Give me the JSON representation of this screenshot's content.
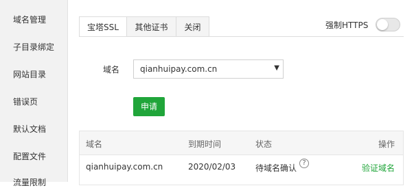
{
  "sidebar": {
    "items": [
      {
        "label": "域名管理"
      },
      {
        "label": "子目录绑定"
      },
      {
        "label": "网站目录"
      },
      {
        "label": "错误页"
      },
      {
        "label": "默认文档"
      },
      {
        "label": "配置文件"
      },
      {
        "label": "流量限制"
      }
    ]
  },
  "tabs": [
    {
      "label": "宝塔SSL",
      "active": true
    },
    {
      "label": "其他证书",
      "active": false
    },
    {
      "label": "关闭",
      "active": false
    }
  ],
  "https": {
    "label": "强制HTTPS",
    "enabled": false
  },
  "form": {
    "domain_label": "域名",
    "domain_value": "qianhuipay.com.cn",
    "apply_label": "申请"
  },
  "table": {
    "headers": [
      "域名",
      "到期时间",
      "状态",
      "操作"
    ],
    "rows": [
      {
        "domain": "qianhuipay.com.cn",
        "expire": "2020/02/03",
        "status": "待域名确认",
        "action": "验证域名"
      }
    ]
  },
  "colors": {
    "accent": "#20a53a"
  }
}
